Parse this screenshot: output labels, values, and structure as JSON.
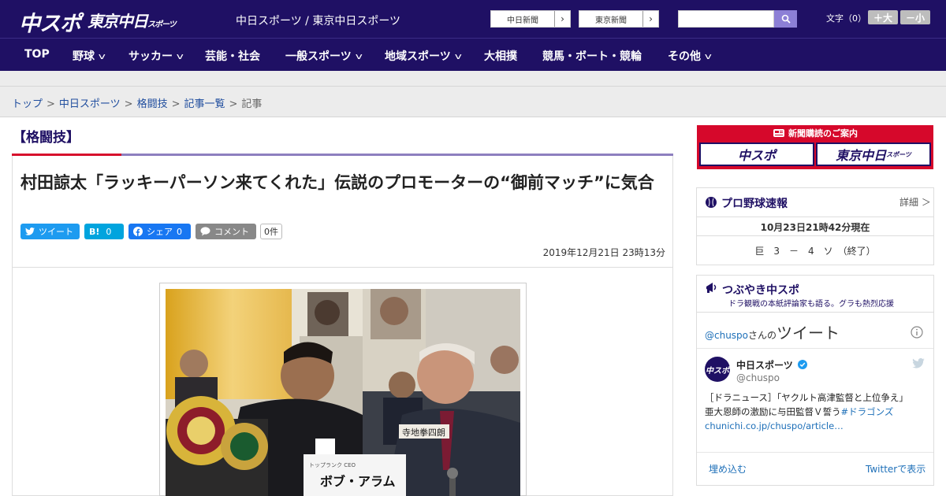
{
  "header": {
    "logo_main": "中スポ",
    "logo_tokyo": "東京中日",
    "logo_tokyo_small": "スポーツ",
    "site_title": "中日スポーツ / 東京中日スポーツ",
    "ext_links": [
      "中日新聞",
      "東京新聞"
    ],
    "search_placeholder": "",
    "font_size_label": "文字（0）",
    "font_plus": "＋大",
    "font_minus": "－小"
  },
  "nav": {
    "items": [
      {
        "label": "TOP"
      },
      {
        "label": "野球"
      },
      {
        "label": "サッカー"
      },
      {
        "label": "芸能・社会"
      },
      {
        "label": "一般スポーツ"
      },
      {
        "label": "地域スポーツ"
      },
      {
        "label": "大相撲"
      },
      {
        "label": "競馬・ボート・競輪"
      },
      {
        "label": "その他"
      }
    ]
  },
  "breadcrumb": {
    "items": [
      "トップ",
      "中日スポーツ",
      "格闘技",
      "記事一覧"
    ],
    "current": "記事"
  },
  "article": {
    "category": "【格闘技】",
    "headline": "村田諒太「ラッキーパーソン来てくれた」伝説のプロモーターの“御前マッチ”に気合",
    "share": {
      "tweet": "ツイート",
      "hatena": "B!",
      "hatena_count": "0",
      "facebook": "シェア",
      "facebook_count": "0",
      "comment": "コメント",
      "comment_count": "0件"
    },
    "date": "2019年12月21日 23時13分",
    "photo_nameplate": "ボブ・アラム",
    "photo_nameplate_small": "トップランク CEO",
    "photo_side_sign": "寺地拳四朗"
  },
  "sidebar": {
    "ad": {
      "title": "新聞購読のご案内",
      "left": "中スポ",
      "right": "東京中日",
      "right_small": "スポーツ"
    },
    "baseball": {
      "title": "プロ野球速報",
      "more": "詳細 ＞",
      "timestamp": "10月23日21時42分現在",
      "score": "巨　3　－　4　ソ　（終了）"
    },
    "tsubuyaki": {
      "title": "つぶやき中スポ",
      "subtitle": "ドラ観戦の本紙評論家も語る。グラも熱烈応援",
      "handle_line": "@chuspo",
      "handle_suffix": "さんの",
      "tweet_heading": "ツイート",
      "account_name": "中日スポーツ",
      "account_handle": "@chuspo",
      "tweet_text_1": "［ドラニュース］「ヤクルト高津監督と上位争え」",
      "tweet_text_2": "亜大恩師の激励に与田監督Ｖ誓う",
      "tweet_hashtag": "#ドラゴンズ",
      "tweet_link": "chunichi.co.jp/chuspo/article…",
      "embed": "埋め込む",
      "view_on_twitter": "Twitterで表示"
    }
  },
  "colors": {
    "header_bg": "#1f1064",
    "accent_red": "#d7102c",
    "twitter": "#1d9bf0",
    "facebook": "#1877f2",
    "hatena": "#00a4de"
  }
}
